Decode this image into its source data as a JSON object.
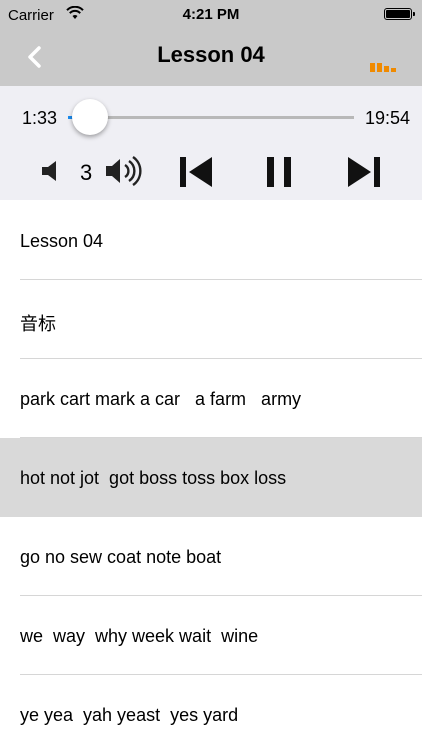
{
  "status_bar": {
    "carrier": "Carrier",
    "time": "4:21 PM"
  },
  "nav": {
    "title": "Lesson 04",
    "back_icon": "chevron-left-icon",
    "right_icon": "equalizer-icon",
    "accent_color": "#f08a00"
  },
  "player": {
    "current_time": "1:33",
    "total_time": "19:54",
    "progress_fraction": 0.078,
    "volume_level": "3",
    "progress_color": "#1a8cf0"
  },
  "list": {
    "items": [
      {
        "label": "Lesson 04",
        "selected": false
      },
      {
        "label": "音标",
        "selected": false
      },
      {
        "label": "park cart mark a car   a farm   army",
        "selected": false
      },
      {
        "label": "hot not jot  got boss toss box loss",
        "selected": true
      },
      {
        "label": "go no sew coat note boat",
        "selected": false
      },
      {
        "label": "we  way  why week wait  wine",
        "selected": false
      },
      {
        "label": "ye yea  yah yeast  yes yard",
        "selected": false
      }
    ]
  }
}
